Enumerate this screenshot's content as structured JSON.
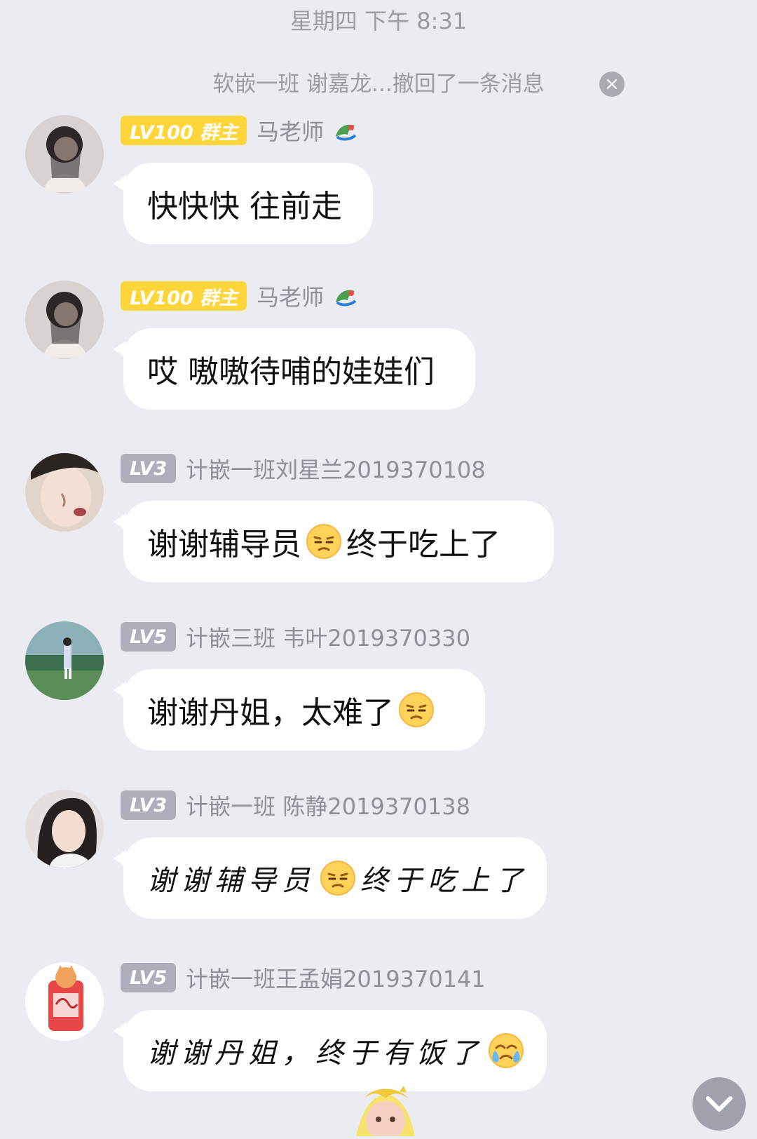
{
  "timestamp": "星期四 下午 8:31",
  "system_notice": "软嵌一班 谢嘉龙...撤回了一条消息",
  "colors": {
    "background": "#ebecf1",
    "bubble": "#ffffff",
    "owner_badge": "#ffd63a",
    "member_badge": "#adb0bb",
    "meta_text": "#8e9099"
  },
  "messages": [
    {
      "badge": "LV100 群主",
      "sender": "马老师",
      "text_before": "快快快 往前走",
      "emoji": "",
      "text_after": "",
      "sender_icon": "dragon-icon"
    },
    {
      "badge": "LV100 群主",
      "sender": "马老师",
      "text_before": "哎 嗷嗷待哺的娃娃们",
      "emoji": "",
      "text_after": "",
      "sender_icon": "dragon-icon"
    },
    {
      "badge": "LV3",
      "sender": "计嵌一班刘星兰2019370108",
      "text_before": "谢谢辅导员",
      "emoji": "annoyed-face-emoji",
      "text_after": "终于吃上了"
    },
    {
      "badge": "LV5",
      "sender": "计嵌三班 韦叶2019370330",
      "text_before": "谢谢丹姐，太难了",
      "emoji": "annoyed-face-emoji",
      "text_after": ""
    },
    {
      "badge": "LV3",
      "sender": "计嵌一班 陈静2019370138",
      "text_before": "谢谢辅导员",
      "emoji": "annoyed-face-emoji",
      "text_after": "终于吃上了",
      "handwritten": true
    },
    {
      "badge": "LV5",
      "sender": "计嵌一班王孟娟2019370141",
      "text_before": "谢谢丹姐，终于有饭了",
      "emoji": "crying-face-emoji",
      "text_after": "",
      "handwritten": true
    }
  ],
  "icons": {
    "close": "close-icon",
    "scroll_down": "chevron-down-icon"
  }
}
